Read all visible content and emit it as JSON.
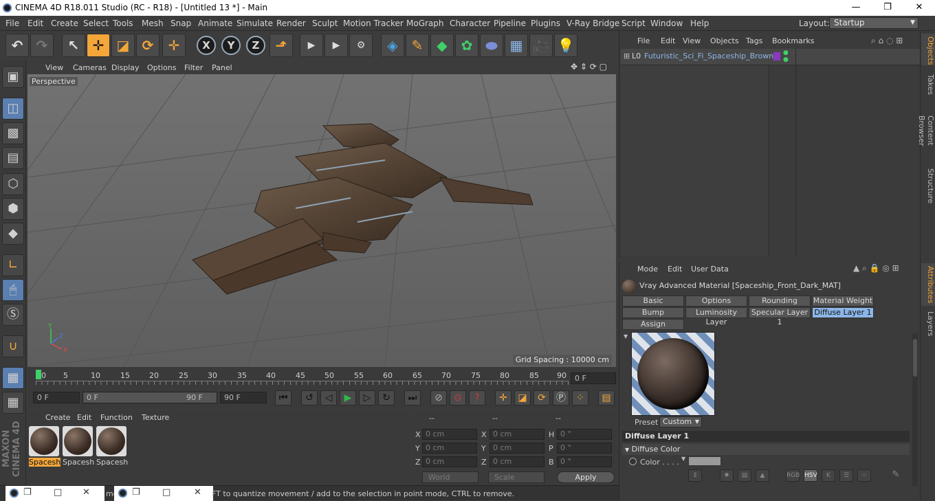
{
  "window": {
    "title": "CINEMA 4D R18.011 Studio (RC - R18) - [Untitled 13 *] - Main",
    "min": "—",
    "max": "❐",
    "close": "✕"
  },
  "menubar": {
    "items": [
      "File",
      "Edit",
      "Create",
      "Select",
      "Tools",
      "Mesh",
      "Snap",
      "Animate",
      "Simulate",
      "Render",
      "Sculpt",
      "Motion Tracker",
      "MoGraph",
      "Character",
      "Pipeline",
      "Plugins",
      "V-Ray Bridge",
      "Script",
      "Window",
      "Help"
    ],
    "layout_label": "Layout:",
    "layout_value": "Startup"
  },
  "toolbar": {
    "axis_x": "X",
    "axis_y": "Y",
    "axis_z": "Z"
  },
  "viewport": {
    "menu": [
      "View",
      "Cameras",
      "Display",
      "Options",
      "Filter",
      "Panel"
    ],
    "camera_label": "Perspective",
    "grid_spacing": "Grid Spacing : 10000 cm",
    "axes": {
      "x": "X",
      "y": "Y",
      "z": "Z"
    }
  },
  "timeline": {
    "ticks": [
      "0",
      "5",
      "10",
      "15",
      "20",
      "25",
      "30",
      "35",
      "40",
      "45",
      "50",
      "55",
      "60",
      "65",
      "70",
      "75",
      "80",
      "85",
      "90"
    ],
    "current_frame": "0 F",
    "start_frame": "0 F",
    "range_start": "0 F",
    "range_end": "90 F",
    "end_frame": "90 F"
  },
  "material_manager": {
    "menu": [
      "Create",
      "Edit",
      "Function",
      "Texture"
    ],
    "materials": [
      {
        "label": "Spacesh",
        "selected": true
      },
      {
        "label": "Spacesh",
        "selected": false
      },
      {
        "label": "Spacesh",
        "selected": false
      }
    ]
  },
  "coordinates": {
    "headers": [
      "--",
      "--",
      "--"
    ],
    "rows": [
      {
        "a": "X",
        "av": "0 cm",
        "b": "X",
        "bv": "0 cm",
        "c": "H",
        "cv": "0 °"
      },
      {
        "a": "Y",
        "av": "0 cm",
        "b": "Y",
        "bv": "0 cm",
        "c": "P",
        "cv": "0 °"
      },
      {
        "a": "Z",
        "av": "0 cm",
        "b": "Z",
        "bv": "0 cm",
        "c": "B",
        "cv": "0 °"
      }
    ],
    "mode1": "World",
    "mode2": "Scale",
    "apply": "Apply"
  },
  "status": {
    "text": "FT to quantize movement / add to the selection in point mode, CTRL to remove.",
    "fragment": "mo"
  },
  "objects": {
    "menu": [
      "File",
      "Edit",
      "View",
      "Objects",
      "Tags",
      "Bookmarks"
    ],
    "rows": [
      {
        "name": "Futuristic_Sci_Fi_Spaceship_Brown",
        "layer": "L0"
      }
    ]
  },
  "right_tabs": [
    "Objects",
    "Takes",
    "Content Browser",
    "Structure",
    "Attributes",
    "Layers"
  ],
  "attributes": {
    "menu": [
      "Mode",
      "Edit",
      "User Data"
    ],
    "material_title": "Vray Advanced Material [Spaceship_Front_Dark_MAT]",
    "tabs": [
      "Basic",
      "Options",
      "Rounding",
      "Material Weight",
      "Bump",
      "Luminosity Layer",
      "Specular Layer 1",
      "Diffuse Layer 1",
      "Assign"
    ],
    "active_tab": "Diffuse Layer 1",
    "preset_label": "Preset",
    "preset_value": "Custom",
    "section": "Diffuse Layer 1",
    "group": "Diffuse Color",
    "color_label": "Color . . . .",
    "icon_buttons": [
      "RGB",
      "HSV",
      "K"
    ]
  }
}
